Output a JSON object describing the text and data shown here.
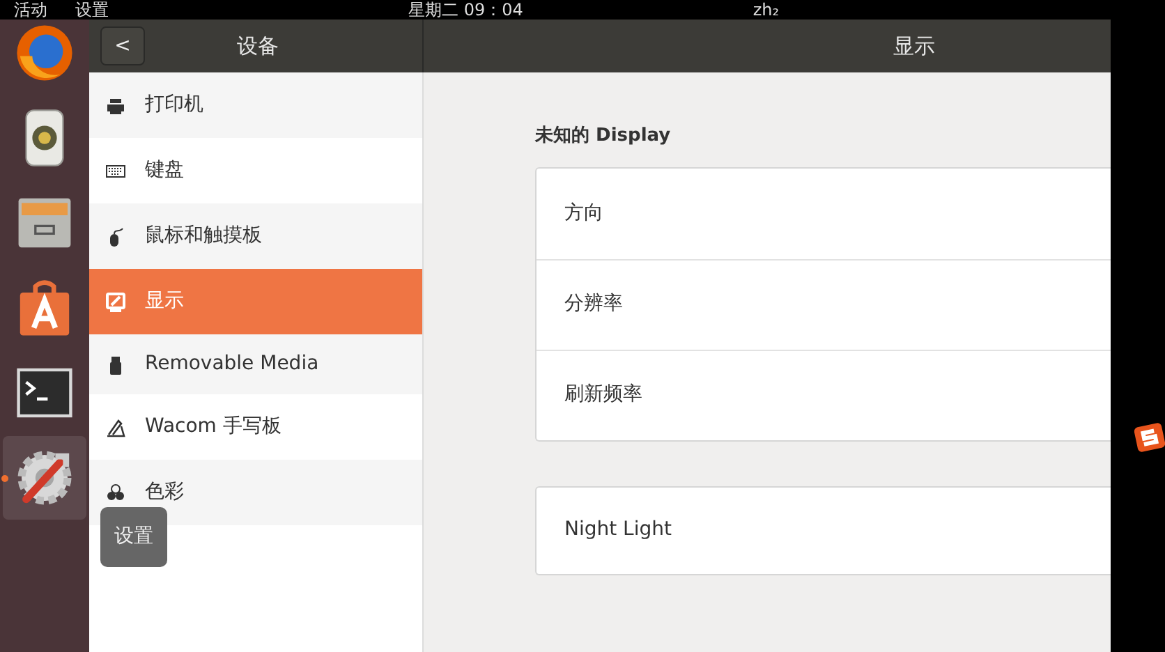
{
  "top_bar": {
    "activities": "活动",
    "app_menu": "设置",
    "clock": "星期二 09：04",
    "input_method": "zh₂"
  },
  "dock": [
    {
      "kind": "firefox",
      "active": false
    },
    {
      "kind": "speaker",
      "active": false
    },
    {
      "kind": "files",
      "active": false
    },
    {
      "kind": "store",
      "active": false
    },
    {
      "kind": "terminal",
      "active": false
    },
    {
      "kind": "settings",
      "active": true
    }
  ],
  "tooltip": "设置",
  "header": {
    "back": "<",
    "sidebar_title": "设备",
    "title": "显示"
  },
  "sidebar": {
    "items": [
      {
        "kind": "printer",
        "label": "打印机",
        "selected": false
      },
      {
        "kind": "keyboard",
        "label": "键盘",
        "selected": false
      },
      {
        "kind": "mouse",
        "label": "鼠标和触摸板",
        "selected": false
      },
      {
        "kind": "display",
        "label": "显示",
        "selected": true
      },
      {
        "kind": "usb",
        "label": "Removable Media",
        "selected": false
      },
      {
        "kind": "tablet",
        "label": "Wacom 手写板",
        "selected": false
      },
      {
        "kind": "color",
        "label": "色彩",
        "selected": false
      }
    ]
  },
  "display": {
    "heading": "未知的 Display",
    "rows": [
      "方向",
      "分辨率",
      "刷新频率"
    ],
    "night_light": "Night Light"
  }
}
